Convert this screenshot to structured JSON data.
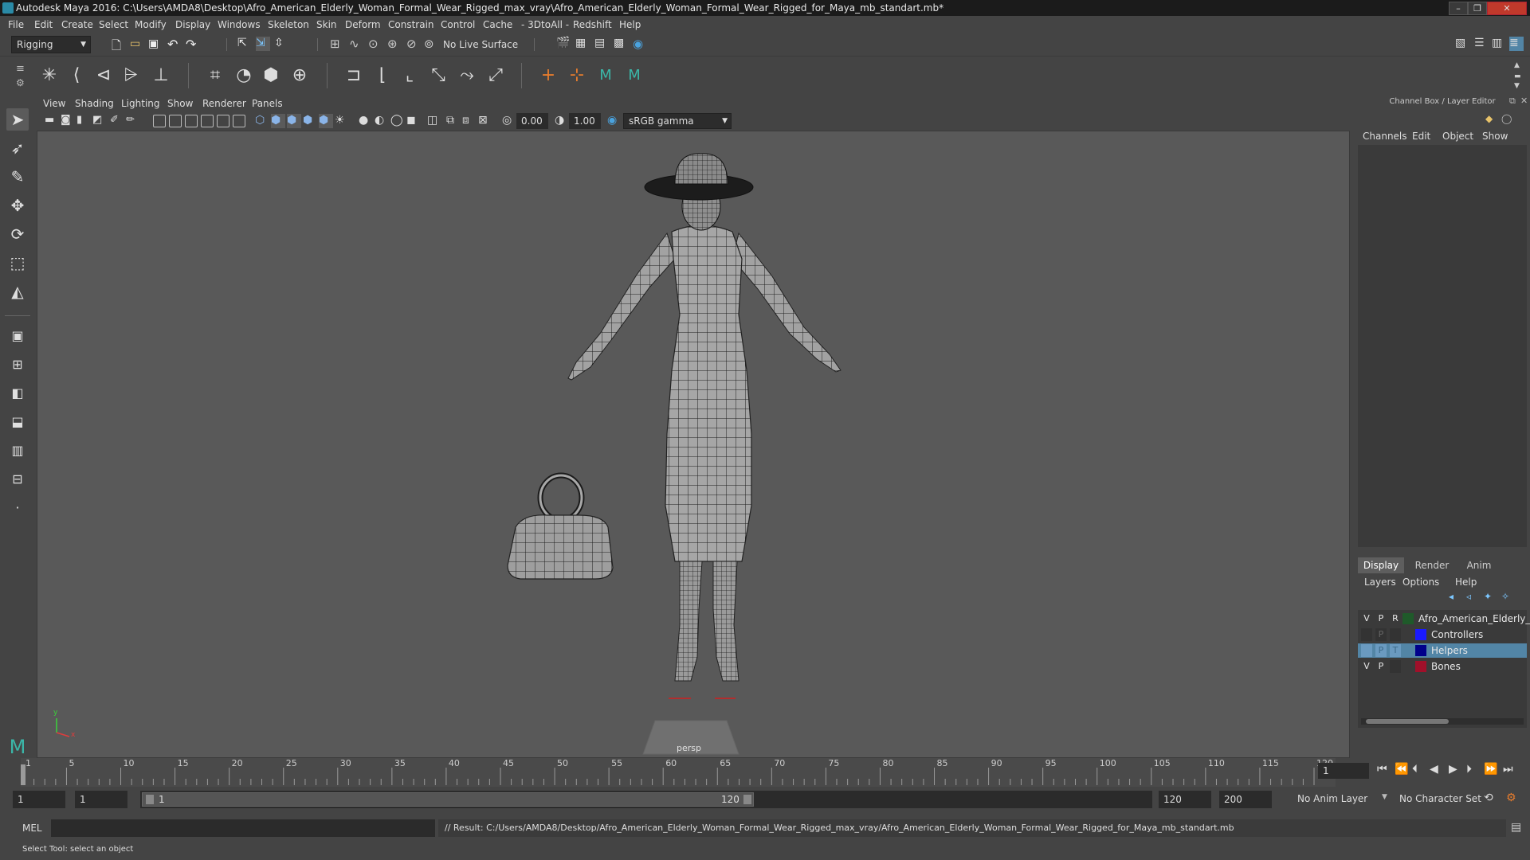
{
  "window": {
    "title": "Autodesk Maya 2016: C:\\Users\\AMDA8\\Desktop\\Afro_American_Elderly_Woman_Formal_Wear_Rigged_max_vray\\Afro_American_Elderly_Woman_Formal_Wear_Rigged_for_Maya_mb_standart.mb*"
  },
  "menubar": [
    "File",
    "Edit",
    "Create",
    "Select",
    "Modify",
    "Display",
    "Windows",
    "Skeleton",
    "Skin",
    "Deform",
    "Constrain",
    "Control",
    "Cache",
    "- 3DtoAll -",
    "Redshift",
    "Help"
  ],
  "statusline": {
    "menu_set": "Rigging",
    "live_surface": "No Live Surface"
  },
  "viewport": {
    "menu": [
      "View",
      "Shading",
      "Lighting",
      "Show",
      "Renderer",
      "Panels"
    ],
    "exposure": "0.00",
    "gamma": "1.00",
    "color_space": "sRGB gamma",
    "camera_label": "persp",
    "axis_y": "y",
    "axis_x": "x"
  },
  "channel_box": {
    "title": "Channel Box / Layer Editor",
    "tabs": [
      "Channels",
      "Edit",
      "Object",
      "Show"
    ]
  },
  "layer_editor": {
    "tabs": [
      "Display",
      "Render",
      "Anim"
    ],
    "selected_tab": "Display",
    "menu": [
      "Layers",
      "Options",
      "Help"
    ],
    "layers": [
      {
        "v": "V",
        "p": "P",
        "r": "R",
        "color": "#1f5a2a",
        "name": "Afro_American_Elderly_W",
        "selected": false
      },
      {
        "v": "",
        "p": "P",
        "r": "",
        "color": "#1a1aff",
        "name": "Controllers",
        "selected": false
      },
      {
        "v": "",
        "p": "P",
        "r": "T",
        "color": "#00008b",
        "name": "Helpers",
        "selected": true
      },
      {
        "v": "V",
        "p": "P",
        "r": "",
        "color": "#a0102a",
        "name": "Bones",
        "selected": false
      }
    ]
  },
  "timeline": {
    "ticks": [
      "5",
      "10",
      "15",
      "20",
      "25",
      "30",
      "35",
      "40",
      "45",
      "50",
      "55",
      "60",
      "65",
      "70",
      "75",
      "80",
      "85",
      "90",
      "95",
      "100",
      "105",
      "110",
      "115",
      "120"
    ],
    "first_tick": "1",
    "current_frame": "1"
  },
  "range": {
    "start": "1",
    "playback_start": "1",
    "slider_start": "1",
    "slider_end": "120",
    "playback_end": "120",
    "end": "200",
    "anim_layer": "No Anim Layer",
    "character_set": "No Character Set"
  },
  "command": {
    "mode": "MEL",
    "result": "// Result: C:/Users/AMDA8/Desktop/Afro_American_Elderly_Woman_Formal_Wear_Rigged_max_vray/Afro_American_Elderly_Woman_Formal_Wear_Rigged_for_Maya_mb_standart.mb"
  },
  "helpline": "Select Tool: select an object"
}
